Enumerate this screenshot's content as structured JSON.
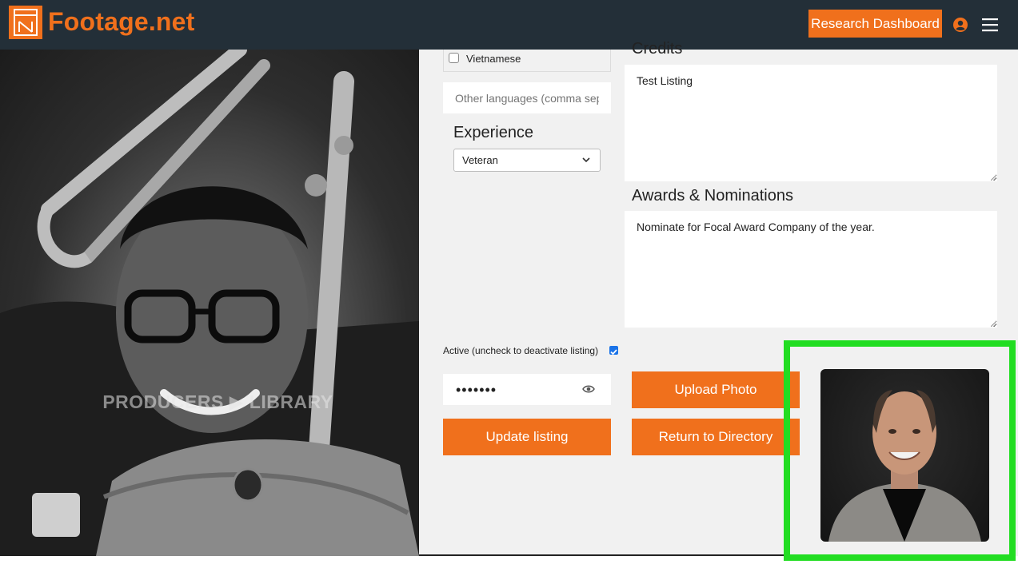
{
  "header": {
    "logo_text": "Footage.net",
    "research_button_label": "Research Dashboard",
    "user_icon": "user-circle-icon",
    "menu_icon": "hamburger-menu-icon"
  },
  "hero": {
    "watermark": "PRODUCERS ▶ LIBRARY"
  },
  "languages": {
    "items": [
      {
        "label": "Vietnamese",
        "checked": false
      }
    ],
    "other_placeholder": "Other languages (comma separated)"
  },
  "experience": {
    "title": "Experience",
    "selected": "Veteran"
  },
  "credits": {
    "title": "Credits",
    "value": "Test Listing"
  },
  "awards": {
    "title": "Awards & Nominations",
    "value": "Nominate for Focal Award Company of the year."
  },
  "active": {
    "label": "Active (uncheck to deactivate listing)",
    "checked": true
  },
  "password": {
    "value": "•••••••"
  },
  "buttons": {
    "upload_photo": "Upload Photo",
    "update_listing": "Update listing",
    "return_directory": "Return to Directory"
  },
  "colors": {
    "brand_orange": "#f0701c",
    "navbar": "#232f38",
    "highlight": "#22dd22"
  }
}
